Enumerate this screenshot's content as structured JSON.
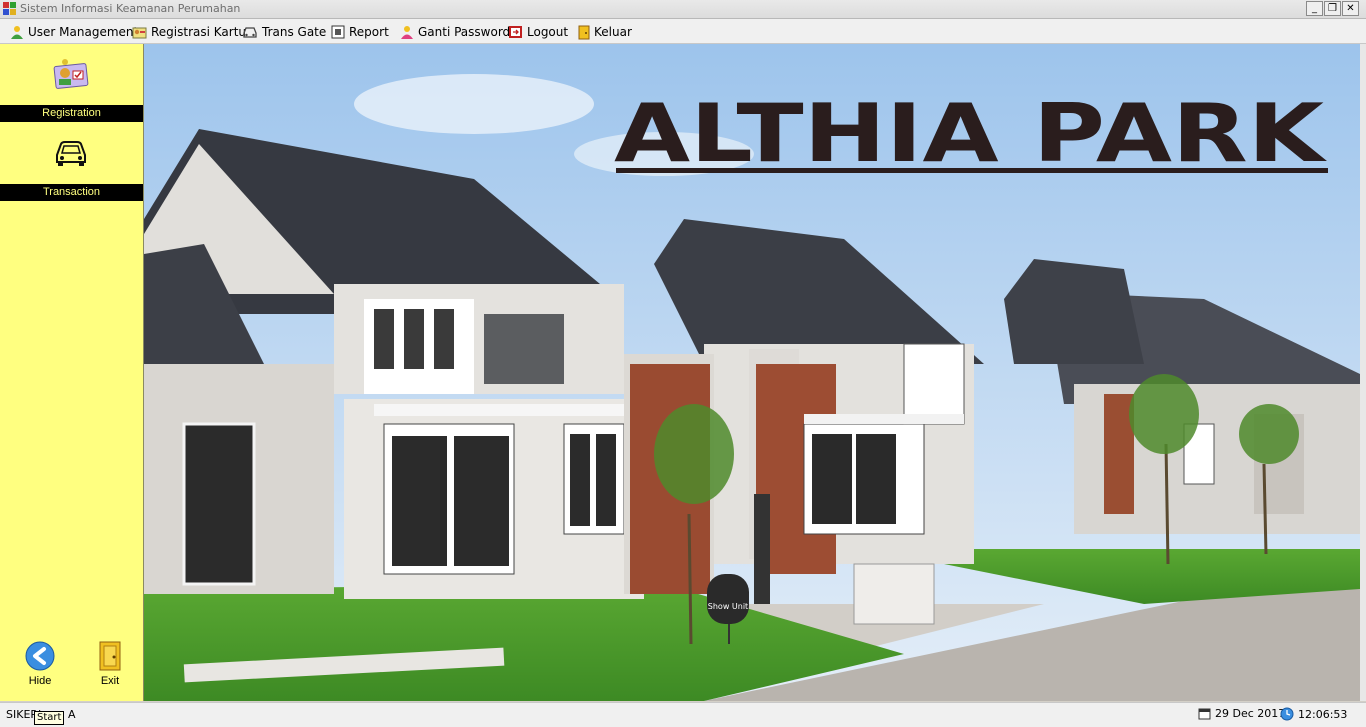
{
  "window": {
    "title": "Sistem Informasi Keamanan Perumahan"
  },
  "menu": [
    {
      "label": "User Management",
      "icon": "user-icon"
    },
    {
      "label": "Registrasi Kartu",
      "icon": "registration-icon"
    },
    {
      "label": "Trans Gate",
      "icon": "car-icon"
    },
    {
      "label": "Report",
      "icon": "report-icon"
    },
    {
      "label": "Ganti Password",
      "icon": "user-key-icon"
    },
    {
      "label": "Logout",
      "icon": "logout-icon"
    },
    {
      "label": "Keluar",
      "icon": "door-exit-icon"
    }
  ],
  "sidebar": {
    "registration_label": "Registration",
    "transaction_label": "Transaction",
    "hide_label": "Hide",
    "exit_label": "Exit"
  },
  "hero": {
    "brand": "ALTHIA PARK",
    "sign": "Show Unit"
  },
  "status": {
    "app": "SIKERI",
    "extra": "A",
    "tooltip": "Start",
    "date": "29 Dec 2017",
    "time": "12:06:53"
  },
  "colors": {
    "sidebar": "#ffff80",
    "label_bg": "#000000",
    "label_text": "#ffff80",
    "brand_text": "#2a1d1d"
  }
}
